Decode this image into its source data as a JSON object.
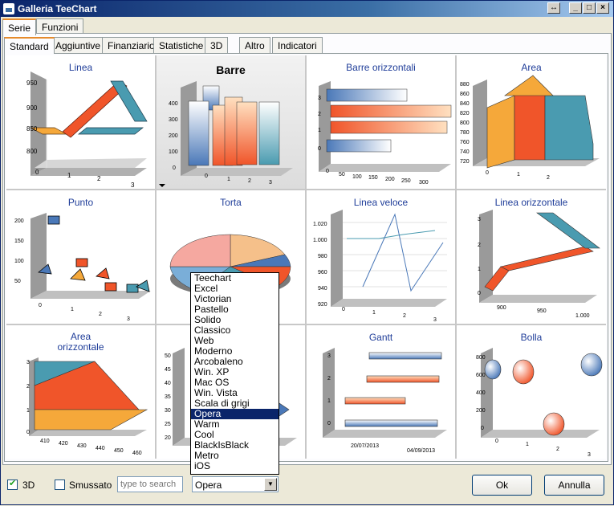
{
  "window": {
    "title": "Galleria TeeChart"
  },
  "main_tabs": [
    {
      "label": "Serie"
    },
    {
      "label": "Funzioni"
    }
  ],
  "sub_tabs": [
    {
      "label": "Standard"
    },
    {
      "label": "Aggiuntive"
    },
    {
      "label": "Finanziario"
    },
    {
      "label": "Statistiche"
    },
    {
      "label": "3D"
    },
    {
      "label": "Altro"
    },
    {
      "label": "Indicatori"
    }
  ],
  "gallery": [
    {
      "title": "Linea",
      "x_ticks": [
        "0",
        "1",
        "2",
        "3"
      ],
      "y_ticks": [
        "950",
        "900",
        "850",
        "800"
      ]
    },
    {
      "title": "Barre",
      "x_ticks": [
        "0",
        "1",
        "2",
        "3"
      ],
      "y_ticks": [
        "400",
        "300",
        "200",
        "100",
        "0"
      ]
    },
    {
      "title": "Barre orizzontali",
      "x_ticks": [
        "0",
        "50",
        "100",
        "150",
        "200",
        "250",
        "300"
      ],
      "y_ticks": [
        "3",
        "2",
        "1",
        "0"
      ]
    },
    {
      "title": "Area",
      "x_ticks": [
        "0",
        "1",
        "2"
      ],
      "y_ticks": [
        "880",
        "860",
        "840",
        "820",
        "800",
        "780",
        "760",
        "740",
        "720"
      ]
    },
    {
      "title": "Punto",
      "x_ticks": [
        "0",
        "1",
        "2",
        "3"
      ],
      "y_ticks": [
        "200",
        "150",
        "100",
        "50"
      ]
    },
    {
      "title": "Torta",
      "x_ticks": [],
      "y_ticks": []
    },
    {
      "title": "Linea veloce",
      "x_ticks": [
        "0",
        "1",
        "2",
        "3"
      ],
      "y_ticks": [
        "1.020",
        "1.000",
        "980",
        "960",
        "940",
        "920"
      ]
    },
    {
      "title": "Linea orizzontale",
      "x_ticks": [
        "900",
        "950",
        "1.000"
      ],
      "y_ticks": [
        "3",
        "2",
        "1",
        "0"
      ]
    },
    {
      "title": "Area\norizzontale",
      "x_ticks": [
        "410",
        "420",
        "430",
        "440",
        "450",
        "460"
      ],
      "y_ticks": [
        "3",
        "2",
        "1",
        "0"
      ]
    },
    {
      "title": "",
      "x_ticks": [],
      "y_ticks": [
        "50",
        "45",
        "40",
        "35",
        "30",
        "25",
        "20"
      ]
    },
    {
      "title": "Gantt",
      "x_ticks": [
        "20/07/2013",
        "04/09/2013"
      ],
      "y_ticks": [
        "3",
        "2",
        "1",
        "0"
      ]
    },
    {
      "title": "Bolla",
      "x_ticks": [
        "0",
        "1",
        "2",
        "3"
      ],
      "y_ticks": [
        "800",
        "600",
        "400",
        "200",
        "0"
      ]
    }
  ],
  "theme_list": {
    "items": [
      "Teechart",
      "Excel",
      "Victorian",
      "Pastello",
      "Solido",
      "Classico",
      "Web",
      "Moderno",
      "Arcobaleno",
      "Win. XP",
      "Mac OS",
      "Win. Vista",
      "Scala di grigi",
      "Opera",
      "Warm",
      "Cool",
      "BlackIsBlack",
      "Metro",
      "iOS"
    ],
    "selected_index": 13
  },
  "bottom": {
    "cb_3d_label": "3D",
    "cb_3d_checked": true,
    "cb_smooth_label": "Smussato",
    "cb_smooth_checked": false,
    "search_placeholder": "type to search",
    "theme_value": "Opera",
    "ok_label": "Ok",
    "cancel_label": "Annulla"
  },
  "colors": {
    "accent_orange": "#f0552a",
    "accent_teal": "#4a9bb0",
    "accent_yellow": "#f5a83a",
    "title_blue": "#1f3d99"
  }
}
